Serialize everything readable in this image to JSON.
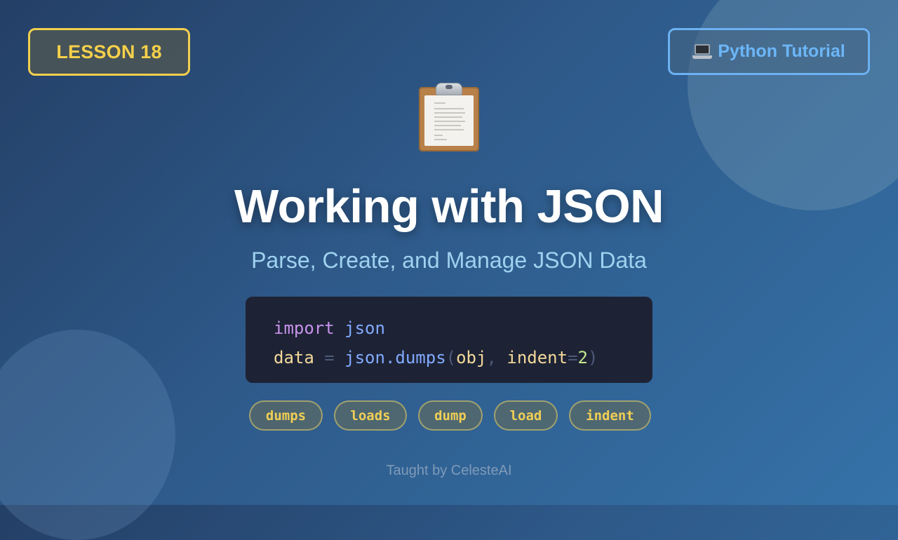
{
  "badges": {
    "lesson": "LESSON 18",
    "tutorial": "Python Tutorial",
    "tutorial_icon": "laptop-icon"
  },
  "hero": {
    "icon": "clipboard-icon",
    "title": "Working with JSON",
    "subtitle": "Parse, Create, and Manage JSON Data"
  },
  "code": {
    "line1": {
      "keyword": "import",
      "module": "json"
    },
    "line2": {
      "var": "data",
      "op": "=",
      "func": "json.dumps",
      "open": "(",
      "arg1": "obj",
      "comma": ",",
      "arg2": "indent",
      "eq": "=",
      "num": "2",
      "close": ")"
    }
  },
  "chips": [
    "dumps",
    "loads",
    "dump",
    "load",
    "indent"
  ],
  "footer": "Taught by CelesteAI",
  "colors": {
    "accent_yellow": "#f2cf4e",
    "accent_blue": "#6cb1f2",
    "code_bg": "#1d2335"
  }
}
